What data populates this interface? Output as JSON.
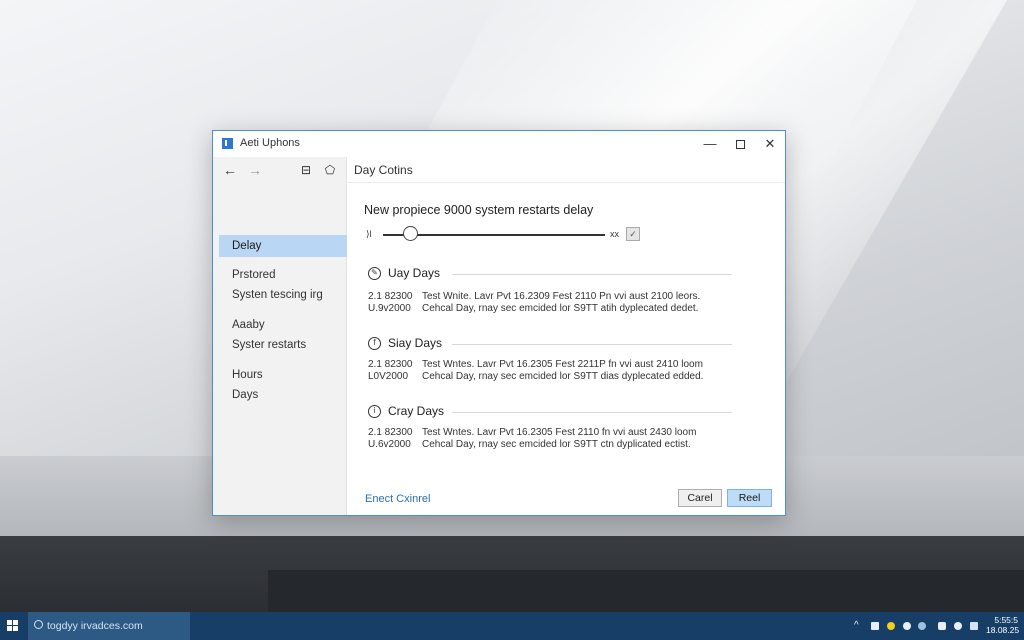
{
  "window": {
    "title": "Aeti Uphons",
    "minimize": "—",
    "close": "✕"
  },
  "nav": {
    "back": "←",
    "forward": "→",
    "icon3": "⊟",
    "icon4": "⬠"
  },
  "sidebar": {
    "items": [
      {
        "label": "Delay",
        "active": true
      },
      {
        "label": "Prstored"
      },
      {
        "label": "Systen tescing irg"
      },
      {
        "label": "Aaaby"
      },
      {
        "label": "Syster restarts"
      },
      {
        "label": "Hours"
      },
      {
        "label": "Days"
      }
    ]
  },
  "content": {
    "title": "Day Cotins",
    "slider": {
      "label": "New propiece 9000 system restarts delay",
      "min_label": "⟩l",
      "max_label": "xx",
      "check": "✓",
      "value_fraction": 0.12
    },
    "sections": [
      {
        "title": "Uay Days",
        "icon": "✎",
        "rows": [
          {
            "code": "2.1 82300",
            "text": "Test Wnite. Lavr Pvt 16.2309 Fest 2110 Pn vvi aust 2100 leors."
          },
          {
            "code": "U.9v2000",
            "text": "Cehcal Day, rnay sec emcided lor S9TT atih dyplecated dedet."
          }
        ]
      },
      {
        "title": "Siay Days",
        "icon": "f",
        "rows": [
          {
            "code": "2.1 82300",
            "text": "Test Wntes. Lavr Pvt 16.2305 Fest 2211P fn vvi aust 2410 loom"
          },
          {
            "code": "L0V2000",
            "text": "Cehcal Day, rnay sec emcided lor S9TT dias dyplecated edded."
          }
        ]
      },
      {
        "title": "Cray Days",
        "icon": "ⅰ",
        "rows": [
          {
            "code": "2.1 82300",
            "text": "Test Wntes. Lavr Pvt 16.2305 Fest 2110 fn vvi aust 2430 loom"
          },
          {
            "code": "U.6v2000",
            "text": "Cehcal Day, rnay sec emcided lor S9TT ctn dyplicated ectist."
          }
        ]
      }
    ],
    "footer_link": "Enect Cxinrel",
    "cancel_label": "Carel",
    "ok_label": "Reel"
  },
  "taskbar": {
    "search_text": "togdyy irvadces.com",
    "tray_chevron": "^",
    "clock_time": "5:55:5",
    "clock_date": "18.08.25"
  },
  "colors": {
    "accent": "#2b79d0",
    "selection": "#b9d7f5",
    "taskbar": "#163e66"
  }
}
